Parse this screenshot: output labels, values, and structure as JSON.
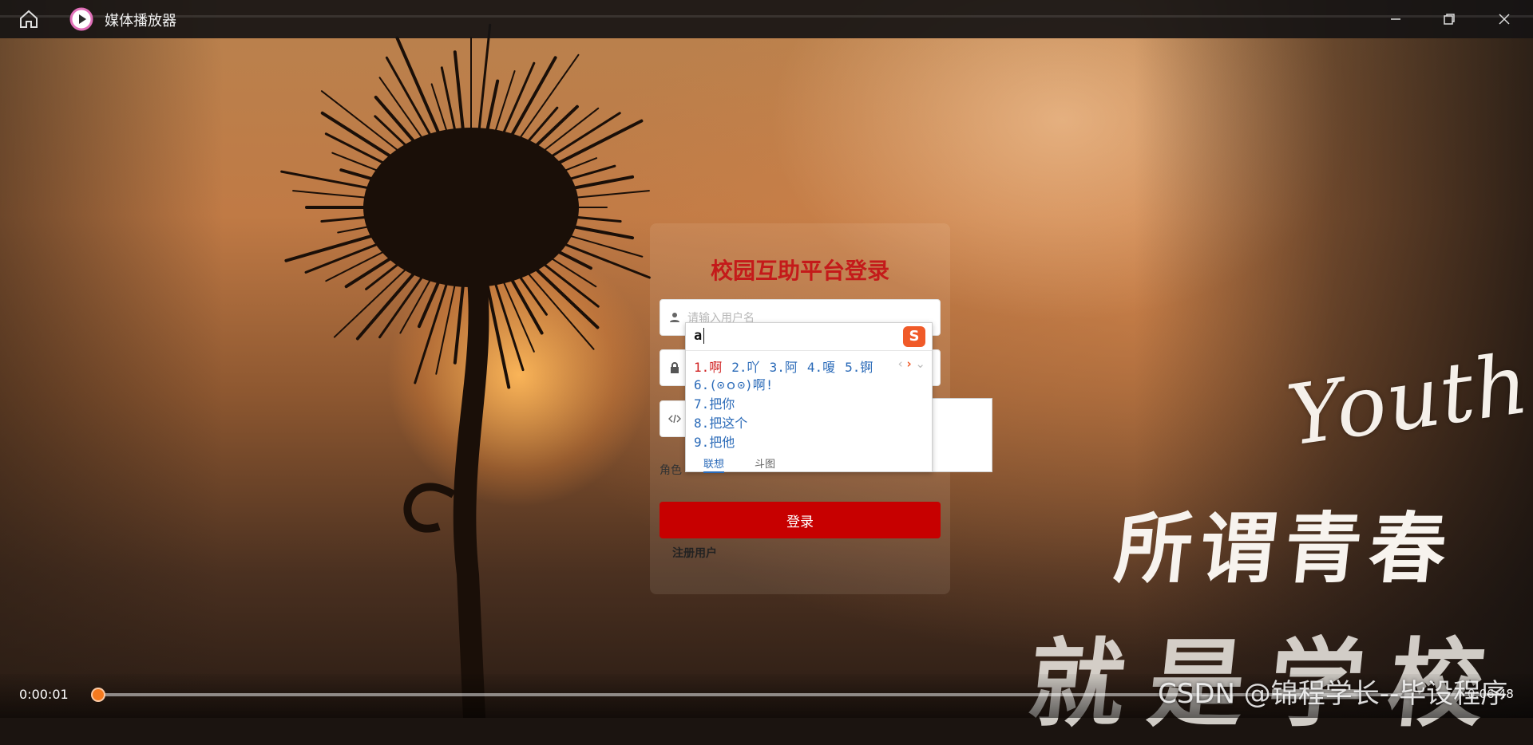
{
  "window": {
    "title": "媒体播放器",
    "home_icon": "home-icon",
    "app_icon": "play-circle-icon",
    "controls": [
      "minimize-icon",
      "restore-icon",
      "close-icon"
    ]
  },
  "login": {
    "title": "校园互助平台登录",
    "username_placeholder": "请输入用户名",
    "password_placeholder": "",
    "captcha_placeholder": "",
    "role_label": "角色",
    "login_button": "登录",
    "register_link": "注册用户",
    "accent_color": "#c70000"
  },
  "ime": {
    "input": "a",
    "logo": "S",
    "candidates_row": [
      {
        "label": "1.啊"
      },
      {
        "label": "2.吖"
      },
      {
        "label": "3.阿"
      },
      {
        "label": "4.嗄"
      },
      {
        "label": "5.锕"
      }
    ],
    "nav": {
      "prev": "‹",
      "next": "›",
      "expand": "⌄"
    },
    "list": [
      {
        "label": "6.(⊙ｏ⊙)啊!"
      },
      {
        "label": "7.把你"
      },
      {
        "label": "8.把这个"
      },
      {
        "label": "9.把他"
      }
    ],
    "tabs": [
      "联想",
      "斗图"
    ]
  },
  "overlay": {
    "youth": "Youth",
    "line1": "所谓青春",
    "line2": "就是学校",
    "watermark": "CSDN @锦程学长--毕设程序"
  },
  "player": {
    "current_time": "0:00:01",
    "total_time": "0:06:48",
    "progress_fraction": 0.003,
    "accent": "#f57a1f"
  }
}
